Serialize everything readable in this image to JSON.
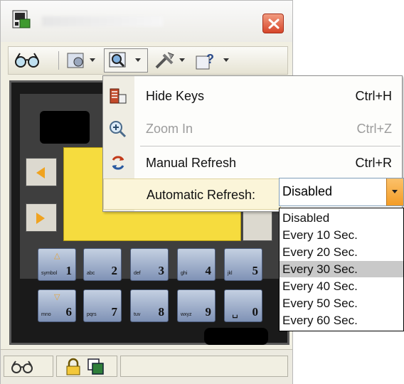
{
  "menu": {
    "items": [
      {
        "label": "Hide Keys",
        "shortcut": "Ctrl+H",
        "icon": "hide-keys-icon"
      },
      {
        "label": "Zoom In",
        "shortcut": "Ctrl+Z",
        "icon": "zoom-in-icon",
        "disabled": true
      },
      {
        "label": "Manual Refresh",
        "shortcut": "Ctrl+R",
        "icon": "refresh-icon"
      },
      {
        "label": "Automatic Refresh:"
      }
    ]
  },
  "auto_refresh": {
    "selected": "Disabled",
    "options": [
      "Disabled",
      "Every 10 Sec.",
      "Every 20 Sec.",
      "Every 30 Sec.",
      "Every 40 Sec.",
      "Every 50 Sec.",
      "Every 60 Sec."
    ],
    "highlighted": "Every 30 Sec."
  },
  "keypad": {
    "row1": [
      {
        "sub": "symbol",
        "num": "1",
        "arrow": "△"
      },
      {
        "sub": "abc",
        "num": "2"
      },
      {
        "sub": "def",
        "num": "3"
      },
      {
        "sub": "ghi",
        "num": "4"
      },
      {
        "sub": "jkl",
        "num": "5"
      }
    ],
    "row2": [
      {
        "sub": "mno",
        "num": "6",
        "arrow": "▽"
      },
      {
        "sub": "pqrs",
        "num": "7"
      },
      {
        "sub": "tuv",
        "num": "8"
      },
      {
        "sub": "wxyz",
        "num": "9"
      },
      {
        "sub": "␣",
        "num": "0"
      }
    ]
  },
  "icons": {
    "app": "app-icon",
    "close": "close-icon",
    "glasses": "glasses-icon",
    "lock": "lock-icon",
    "copy": "copy-icon"
  },
  "colors": {
    "menu_highlight": "#fbf5d9",
    "combo_button": "#f39c25",
    "screen": "#f6dc3e",
    "key": "#9aaac6"
  }
}
